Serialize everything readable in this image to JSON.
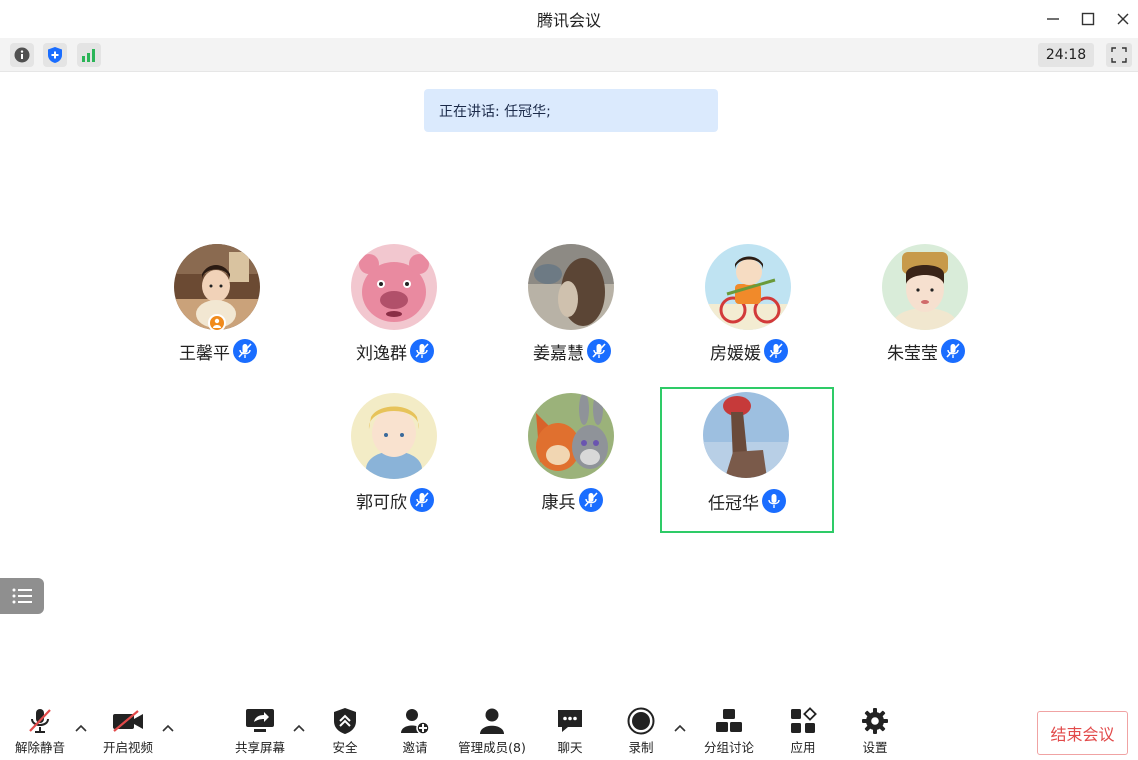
{
  "window": {
    "title": "腾讯会议"
  },
  "infobar": {
    "timer": "24:18"
  },
  "speaking_banner": "正在讲话: 任冠华;",
  "participants": [
    {
      "name": "王馨平",
      "host": true,
      "speaking": false
    },
    {
      "name": "刘逸群",
      "host": false,
      "speaking": false
    },
    {
      "name": "姜嘉慧",
      "host": false,
      "speaking": false
    },
    {
      "name": "房媛媛",
      "host": false,
      "speaking": false
    },
    {
      "name": "朱莹莹",
      "host": false,
      "speaking": false
    },
    {
      "name": "郭可欣",
      "host": false,
      "speaking": false
    },
    {
      "name": "康兵",
      "host": false,
      "speaking": false
    },
    {
      "name": "任冠华",
      "host": false,
      "speaking": true
    }
  ],
  "toolbar": {
    "unmute": "解除静音",
    "start_video": "开启视频",
    "share_screen": "共享屏幕",
    "security": "安全",
    "invite": "邀请",
    "manage_members": "管理成员(8)",
    "chat": "聊天",
    "record": "录制",
    "breakout": "分组讨论",
    "apps": "应用",
    "settings": "设置",
    "end_meeting": "结束会议"
  },
  "colors": {
    "accent": "#1a6dff",
    "active_border": "#2ecb67",
    "end": "#e24a4a",
    "banner": "#dbeafd"
  }
}
